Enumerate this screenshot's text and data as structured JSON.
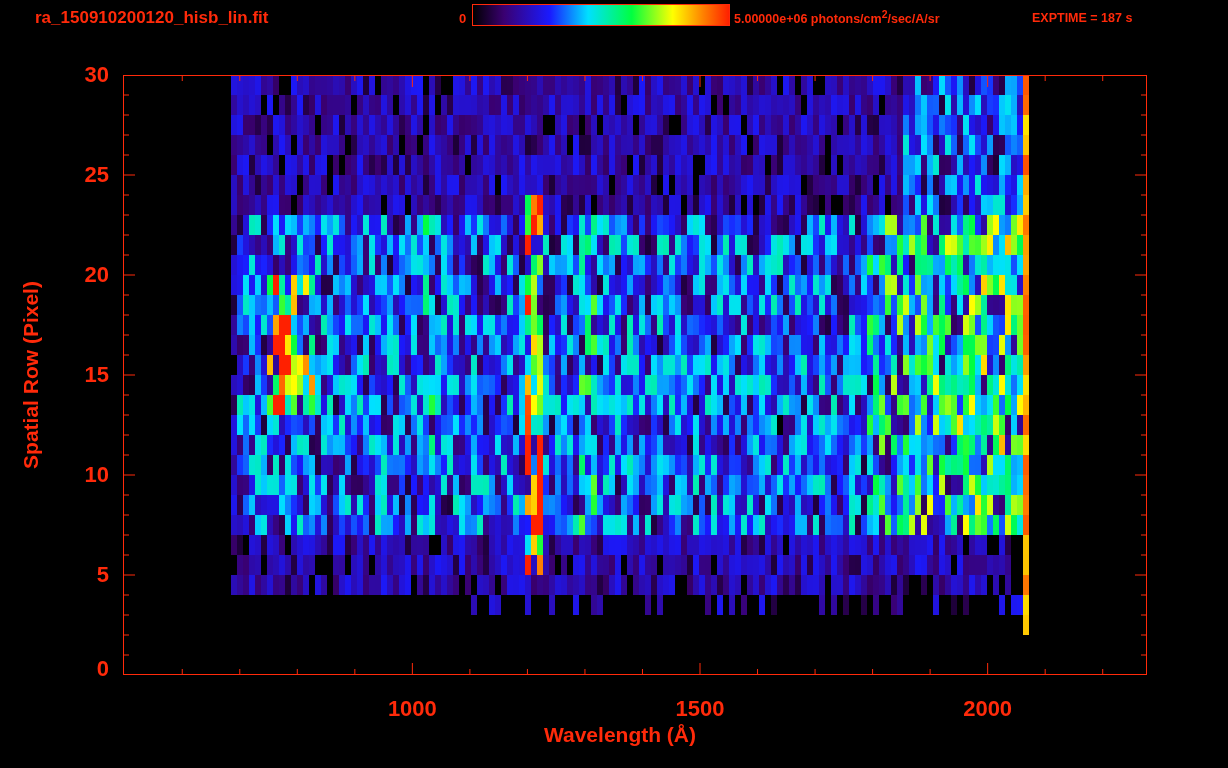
{
  "title": "ra_150910200120_hisb_lin.fit",
  "colorbar": {
    "min_label": "0",
    "max_label": "5.00000e+06 photons/cm$^{2}$/sec/A/sr"
  },
  "exposure": "EXPTIME = 187 s",
  "plot": {
    "ylabel": "Spatial Row (Pixel)",
    "xlabel": "Wavelength (Å)",
    "yticks": [
      "30",
      "25",
      "20",
      "15",
      "10",
      "5",
      "0"
    ],
    "xticks": [
      "1000",
      "1500",
      "2000"
    ]
  }
}
